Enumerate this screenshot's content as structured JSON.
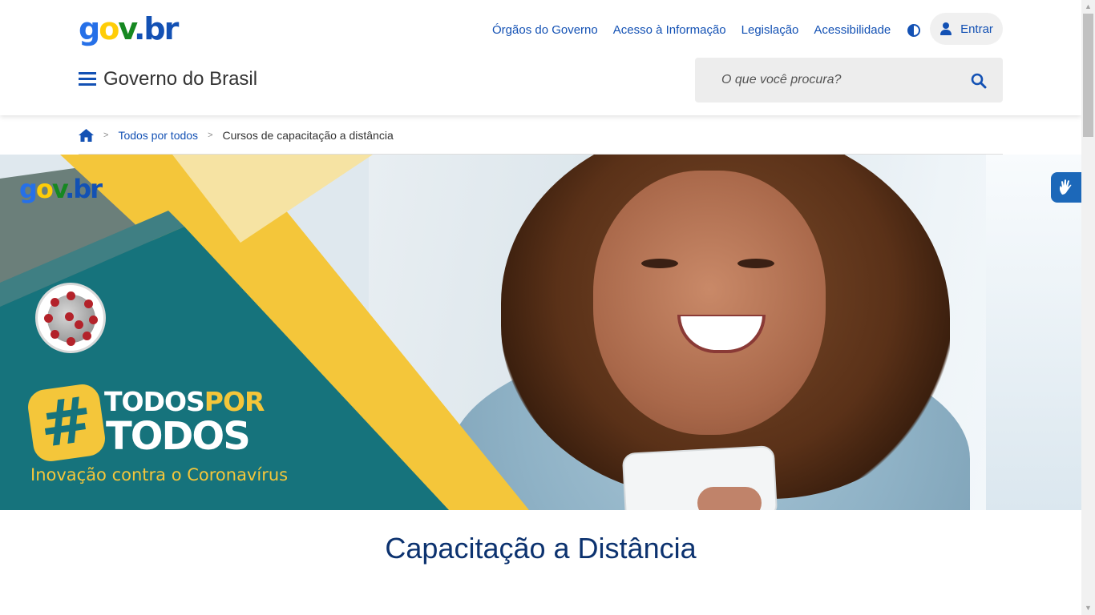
{
  "header": {
    "logo": {
      "g": "g",
      "o": "o",
      "v": "v",
      "dotbr": ".br"
    },
    "links": [
      "Órgãos do Governo",
      "Acesso à Informação",
      "Legislação",
      "Acessibilidade"
    ],
    "login_label": "Entrar",
    "site_title": "Governo do Brasil",
    "search_placeholder": "O que você procura?"
  },
  "breadcrumb": {
    "items": [
      "Todos por todos",
      "Cursos de capacitação a distância"
    ],
    "separator": ">"
  },
  "banner": {
    "logo": {
      "g": "g",
      "o": "o",
      "v": "v",
      "dotbr": ".br"
    },
    "title_line1_a": "TODOS",
    "title_line1_b": "POR",
    "title_line2": "TODOS",
    "hash": "#",
    "tagline": "Inovação contra o Coronavírus"
  },
  "main": {
    "heading": "Capacitação a Distância"
  },
  "colors": {
    "primary": "#1351b4",
    "heading": "#0c326f",
    "teal": "#16737c",
    "yellow": "#f4c63a"
  },
  "icons": [
    "home-icon",
    "menu-icon",
    "search-icon",
    "user-icon",
    "contrast-icon",
    "vlibras-icon"
  ]
}
